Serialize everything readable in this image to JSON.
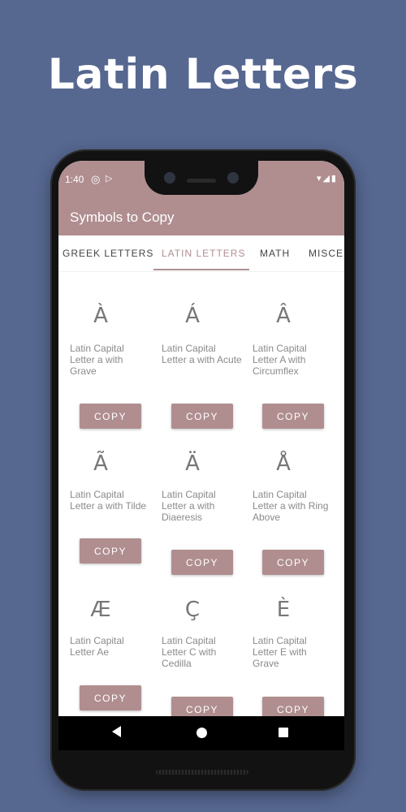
{
  "promo": {
    "title": "Latin Letters"
  },
  "status": {
    "time": "1:40"
  },
  "app": {
    "title": "Symbols to Copy"
  },
  "tabs": [
    {
      "label": "GREEK LETTERS",
      "active": false
    },
    {
      "label": "LATIN LETTERS",
      "active": true
    },
    {
      "label": "MATH",
      "active": false
    },
    {
      "label": "MISCEL",
      "active": false
    }
  ],
  "symbols": [
    {
      "glyph": "À",
      "desc": "Latin Capital Letter a with Grave"
    },
    {
      "glyph": "Á",
      "desc": "Latin Capital Letter a with Acute"
    },
    {
      "glyph": "Â",
      "desc": "Latin Capital Letter A with Circumflex"
    },
    {
      "glyph": "Ã",
      "desc": "Latin Capital Letter a with Tilde"
    },
    {
      "glyph": "Ä",
      "desc": "Latin Capital Letter a with Diaeresis"
    },
    {
      "glyph": "Å",
      "desc": "Latin Capital Letter a with Ring Above"
    },
    {
      "glyph": "Æ",
      "desc": "Latin Capital Letter Ae"
    },
    {
      "glyph": "Ç",
      "desc": "Latin Capital Letter C with Cedilla"
    },
    {
      "glyph": "È",
      "desc": "Latin Capital Letter E with Grave"
    }
  ],
  "copy_label": "COPY",
  "colors": {
    "background": "#566790",
    "accent": "#b08e90"
  },
  "nav_icons": [
    "back-icon",
    "home-icon",
    "recents-icon"
  ]
}
